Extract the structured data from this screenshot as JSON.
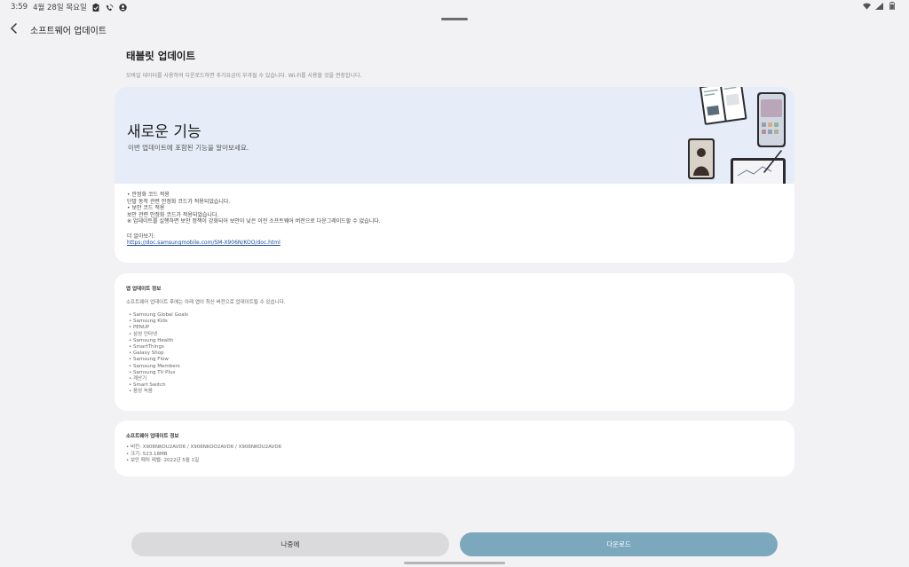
{
  "status_bar": {
    "time": "3:59",
    "date": "4월 28일 목요일",
    "battery": "",
    "icons_left": [
      "clipboard-icon",
      "wifi-calling-icon",
      "account-icon"
    ],
    "icons_right": [
      "wifi-icon",
      "signal-icon",
      "battery-icon"
    ]
  },
  "header": {
    "title": "소프트웨어 업데이트",
    "back_icon": "chevron-left-icon"
  },
  "page": {
    "title": "태블릿 업데이트",
    "note": "모바일 데이터를 사용하여 다운로드하면 추가요금이 부과될 수 있습니다. Wi-Fi를 사용할 것을 권장합니다."
  },
  "hero": {
    "title": "새로운 기능",
    "subtitle": "이번 업데이트에 포함된 기능을 알아보세요."
  },
  "release_notes": {
    "lines": [
      "• 안정화 코드 적용",
      "단말 동작 관련 안정화 코드가 적용되었습니다.",
      "• 보안 코드 적용",
      "보안 관련 안정화 코드가 적용되었습니다.",
      "※ 업데이트를 실행하면 보안 정책이 강화되어 보안이 낮은 이전 소프트웨어 버전으로 다운그레이드할 수 없습니다."
    ],
    "more_label": "더 알아보기:",
    "more_link": "https://doc.samsungmobile.com/SM-X906N/KOO/doc.html"
  },
  "app_updates": {
    "heading": "앱 업데이트 정보",
    "description": "소프트웨어 업데이트 후에는 아래 앱이 최신 버전으로 업데이트될 수 있습니다.",
    "apps": [
      "• Samsung Global Goals",
      "• Samsung Kids",
      "• PENUP",
      "• 삼성 인터넷",
      "• Samsung Health",
      "• SmartThings",
      "• Galaxy Shop",
      "• Samsung Flow",
      "• Samsung Members",
      "• Samsung TV Plus",
      "• 계산기",
      "• Smart Switch",
      "• 음성 녹음"
    ]
  },
  "software_info": {
    "heading": "소프트웨어 업데이트 정보",
    "lines": [
      "• 버전: X906NKOU2AVD6 / X906NKOO2AVD6 / X906NKOU2AVD6",
      "• 크기: 523.18MB",
      "• 보안 패치 레벨: 2022년 5월 1일"
    ]
  },
  "buttons": {
    "later": "나중에",
    "download": "다운로드"
  },
  "colors": {
    "hero_background": "#e6edf8",
    "download_button": "#7ba8bd",
    "later_button": "#dadadc",
    "link": "#1d4d9a"
  }
}
